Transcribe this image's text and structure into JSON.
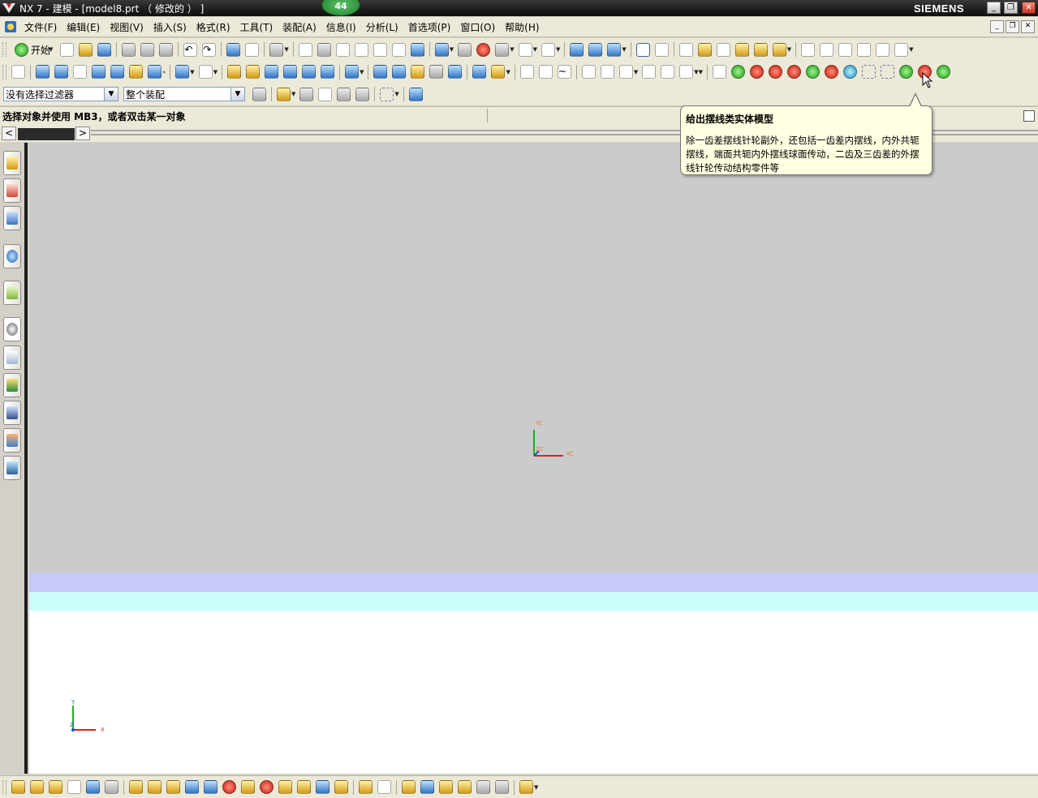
{
  "window": {
    "title": "NX 7 - 建模 - [model8.prt （ 修改的 ） ]",
    "badge": "44",
    "brand": "SIEMENS"
  },
  "menubar": {
    "items": [
      "文件(F)",
      "编辑(E)",
      "视图(V)",
      "插入(S)",
      "格式(R)",
      "工具(T)",
      "装配(A)",
      "信息(I)",
      "分析(L)",
      "首选项(P)",
      "窗口(O)",
      "帮助(H)"
    ]
  },
  "toolbar": {
    "start_label": "开始"
  },
  "selection_bar": {
    "filter_value": "没有选择过滤器",
    "scope_value": "整个装配"
  },
  "cue_line": {
    "text": "选择对象并使用 MB3，或者双击某一对象"
  },
  "tooltip": {
    "title": "给出摆线类实体模型",
    "body": "除一齿差摆线针轮副外，还包括一齿差内摆线，内外共轭摆线，端面共轭内外摆线球面传动，二齿及三齿差的外摆线针轮传动结构零件等"
  },
  "viewport": {
    "wcs_y_label": "YC",
    "wcs_x_label": "YC",
    "wcs_z_label": "ZC",
    "abs_y_label": "Y",
    "abs_x_label": "X",
    "abs_z_label": "Z",
    "colors": {
      "background_top": "#cbcbcb",
      "band_lavender": "#c9c9f9",
      "band_cyan": "#ccfdfd",
      "background_bottom": "#ffffff",
      "axis_x": "#e02020",
      "axis_y": "#20b020"
    }
  }
}
